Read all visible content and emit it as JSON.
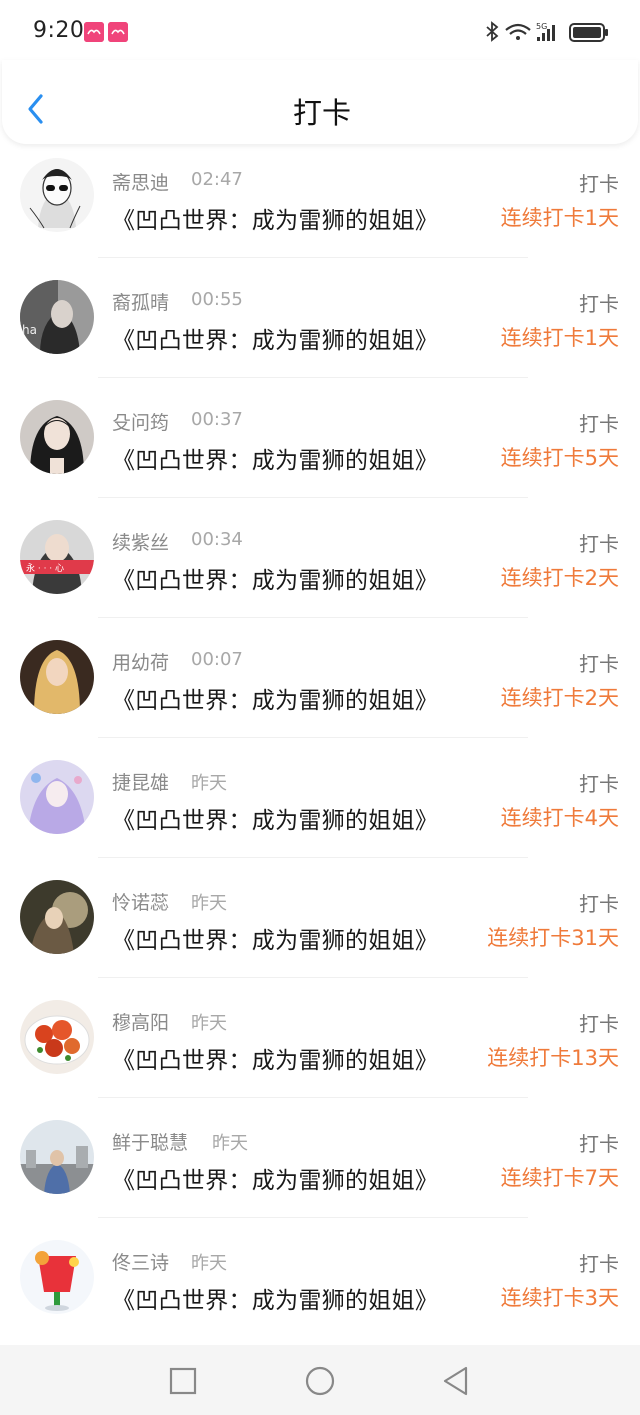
{
  "status_bar": {
    "time": "9:20",
    "notification_icons": [
      "weibo-icon",
      "weibo-icon"
    ],
    "right_icons": [
      "bluetooth-icon",
      "wifi-icon",
      "5g-signal-icon",
      "battery-icon"
    ],
    "network_label": "5G"
  },
  "header": {
    "title": "打卡",
    "back_icon": "chevron-left-icon"
  },
  "colors": {
    "accent_blue": "#2a8ff0",
    "streak_orange": "#ef7a3a",
    "name_gray": "#8a8a8a"
  },
  "list": {
    "items": [
      {
        "name": "斋思迪",
        "time": "02:47",
        "book": "《凹凸世界：成为雷狮的姐姐》",
        "action": "打卡",
        "streak": "连续打卡1天"
      },
      {
        "name": "裔孤晴",
        "time": "00:55",
        "book": "《凹凸世界：成为雷狮的姐姐》",
        "action": "打卡",
        "streak": "连续打卡1天"
      },
      {
        "name": "殳问筠",
        "time": "00:37",
        "book": "《凹凸世界：成为雷狮的姐姐》",
        "action": "打卡",
        "streak": "连续打卡5天"
      },
      {
        "name": "续紫丝",
        "time": "00:34",
        "book": "《凹凸世界：成为雷狮的姐姐》",
        "action": "打卡",
        "streak": "连续打卡2天"
      },
      {
        "name": "用幼荷",
        "time": "00:07",
        "book": "《凹凸世界：成为雷狮的姐姐》",
        "action": "打卡",
        "streak": "连续打卡2天"
      },
      {
        "name": "捷昆雄",
        "time": "昨天",
        "book": "《凹凸世界：成为雷狮的姐姐》",
        "action": "打卡",
        "streak": "连续打卡4天"
      },
      {
        "name": "怜诺蕊",
        "time": "昨天",
        "book": "《凹凸世界：成为雷狮的姐姐》",
        "action": "打卡",
        "streak": "连续打卡31天"
      },
      {
        "name": "穆高阳",
        "time": "昨天",
        "book": "《凹凸世界：成为雷狮的姐姐》",
        "action": "打卡",
        "streak": "连续打卡13天"
      },
      {
        "name": "鲜于聪慧",
        "time": "昨天",
        "book": "《凹凸世界：成为雷狮的姐姐》",
        "action": "打卡",
        "streak": "连续打卡7天"
      },
      {
        "name": "佟三诗",
        "time": "昨天",
        "book": "《凹凸世界：成为雷狮的姐姐》",
        "action": "打卡",
        "streak": "连续打卡3天"
      }
    ]
  },
  "nav_bar": {
    "buttons": [
      "recent-apps-icon",
      "home-icon",
      "back-icon"
    ]
  }
}
